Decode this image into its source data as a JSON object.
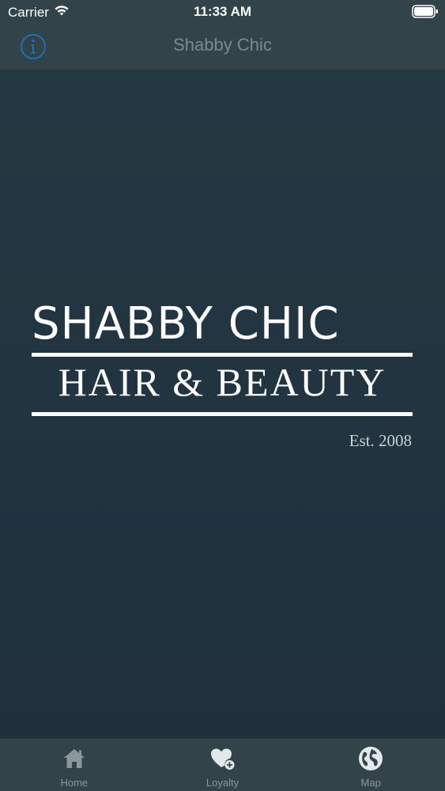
{
  "status_bar": {
    "carrier": "Carrier",
    "time": "11:33 AM"
  },
  "nav": {
    "title": "Shabby Chic",
    "info_icon": "info-icon"
  },
  "logo": {
    "line1": "SHABBY CHIC",
    "line2": "HAIR & BEAUTY",
    "established": "Est. 2008"
  },
  "tabs": [
    {
      "label": "Home",
      "icon": "home-icon"
    },
    {
      "label": "Loyalty",
      "icon": "heart-plus-icon"
    },
    {
      "label": "Map",
      "icon": "globe-icon"
    }
  ],
  "colors": {
    "background": "#213440",
    "bars": "#33434a",
    "accent": "#1f6fb5",
    "tab_inactive": "#8a979c"
  }
}
